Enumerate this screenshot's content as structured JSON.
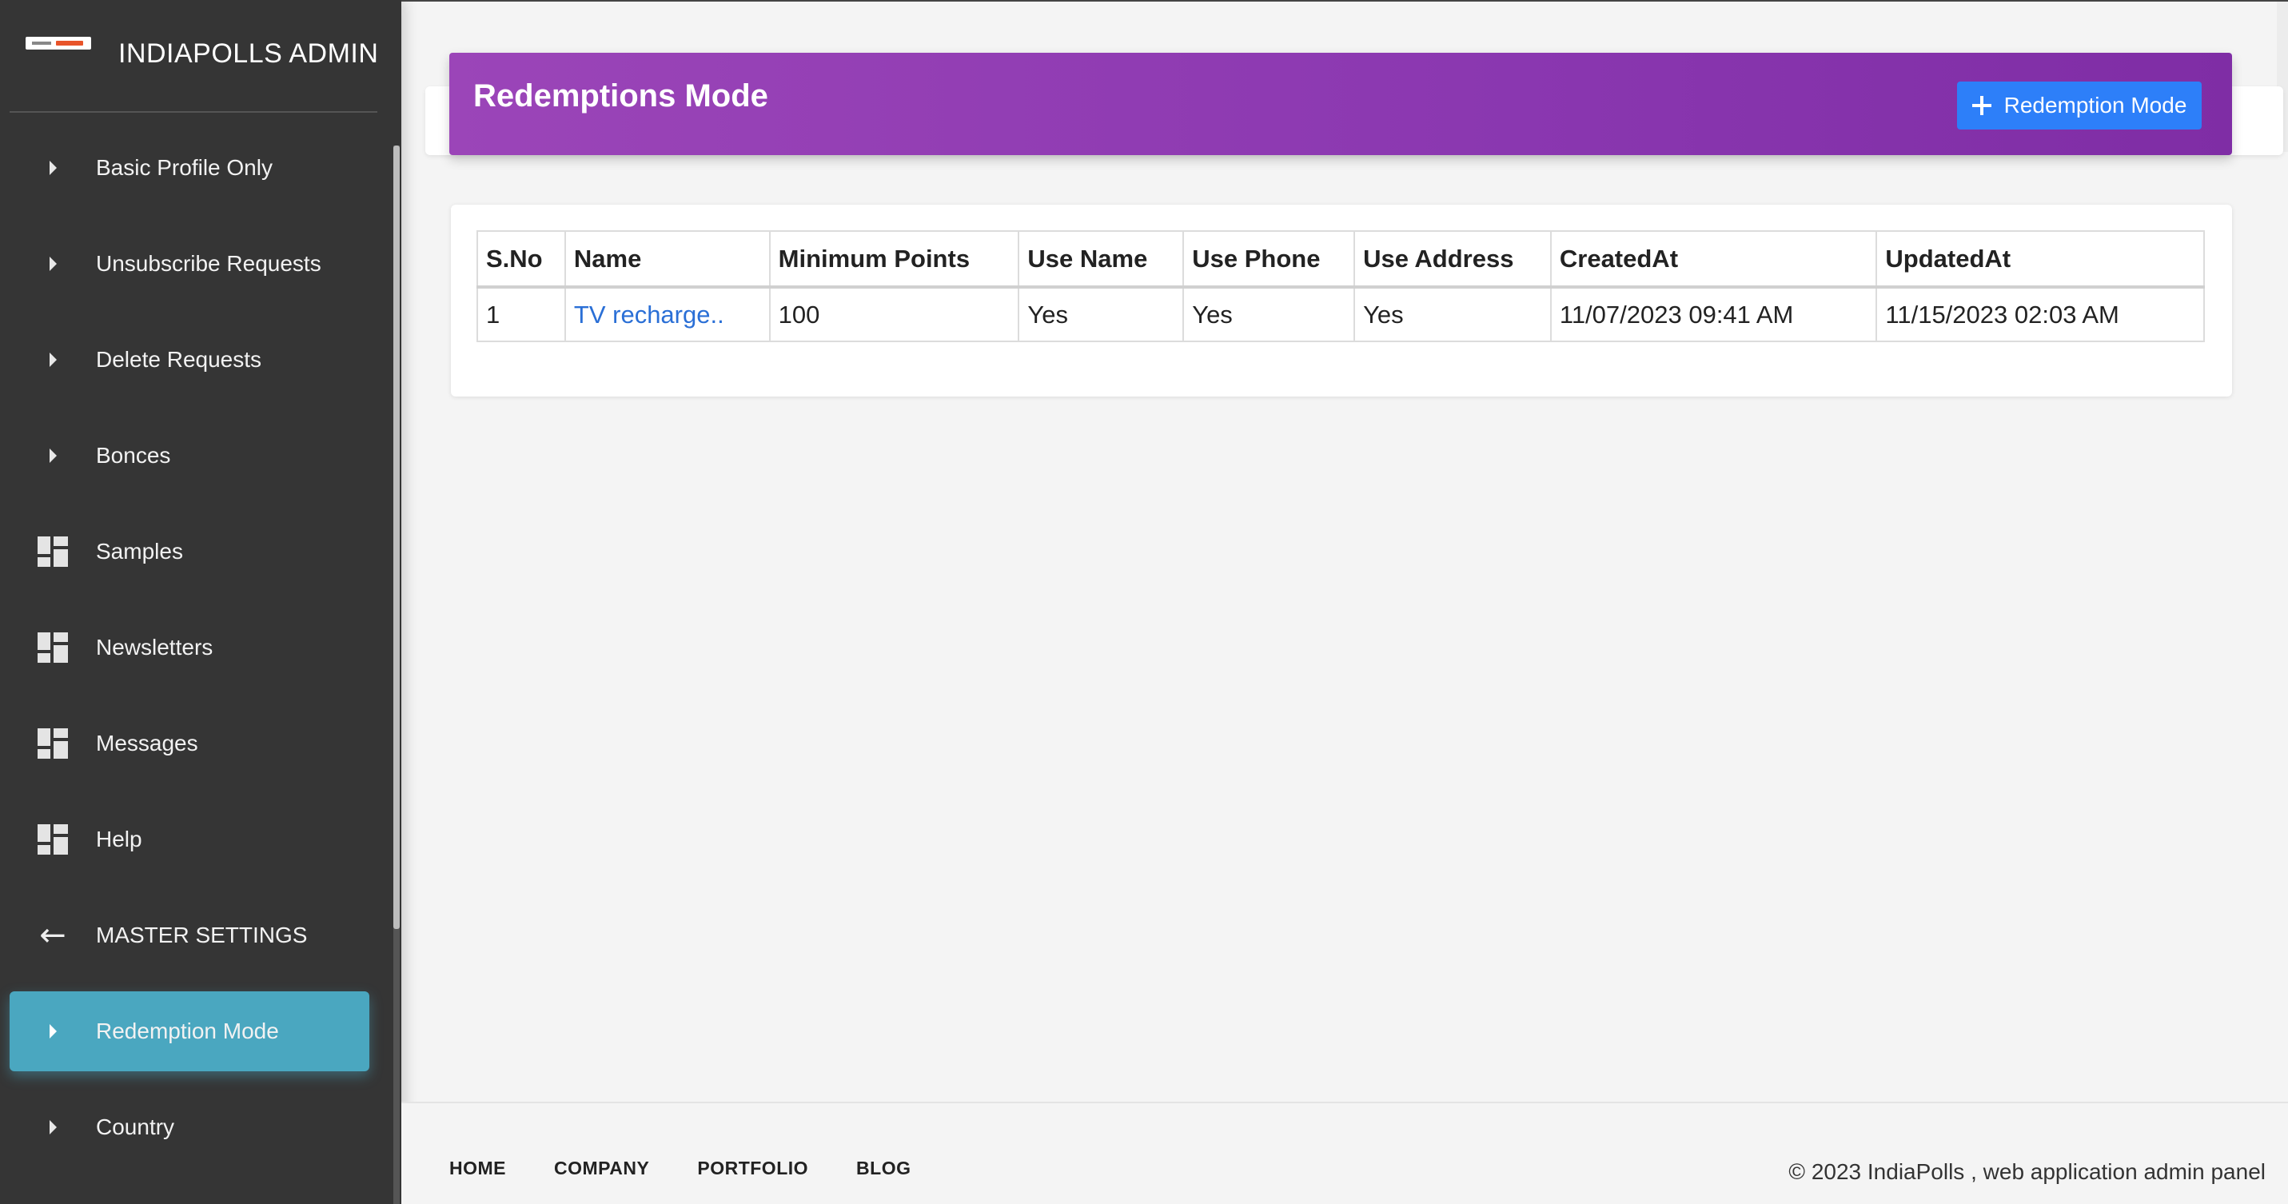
{
  "sidebar": {
    "brand_title": "INDIAPOLLS ADMIN",
    "items": [
      {
        "label": "Basic Profile Only",
        "icon": "caret-right-icon"
      },
      {
        "label": "Unsubscribe Requests",
        "icon": "caret-right-icon"
      },
      {
        "label": "Delete Requests",
        "icon": "caret-right-icon"
      },
      {
        "label": "Bonces",
        "icon": "caret-right-icon"
      },
      {
        "label": "Samples",
        "icon": "dashboard-icon"
      },
      {
        "label": "Newsletters",
        "icon": "dashboard-icon"
      },
      {
        "label": "Messages",
        "icon": "dashboard-icon"
      },
      {
        "label": "Help",
        "icon": "dashboard-icon"
      },
      {
        "label": "MASTER SETTINGS",
        "icon": "arrow-left-icon"
      },
      {
        "label": "Redemption Mode",
        "icon": "caret-right-icon",
        "active": true
      },
      {
        "label": "Country",
        "icon": "caret-right-icon"
      }
    ],
    "active_color": "#4aa7c0",
    "background_color": "#353535"
  },
  "header": {
    "title": "Redemptions Mode",
    "add_button_label": "Redemption Mode",
    "gradient_color": "#9b45b8",
    "button_color": "#2d7ff9"
  },
  "table": {
    "columns": [
      "S.No",
      "Name",
      "Minimum Points",
      "Use Name",
      "Use Phone",
      "Use Address",
      "CreatedAt",
      "UpdatedAt"
    ],
    "rows": [
      [
        "1",
        "TV recharge..",
        "100",
        "Yes",
        "Yes",
        "Yes",
        "11/07/2023 09:41 AM",
        "11/15/2023 02:03 AM"
      ]
    ]
  },
  "footer": {
    "links": [
      "HOME",
      "COMPANY",
      "PORTFOLIO",
      "BLOG"
    ],
    "copyright": "© 2023 IndiaPolls , web application admin panel"
  }
}
